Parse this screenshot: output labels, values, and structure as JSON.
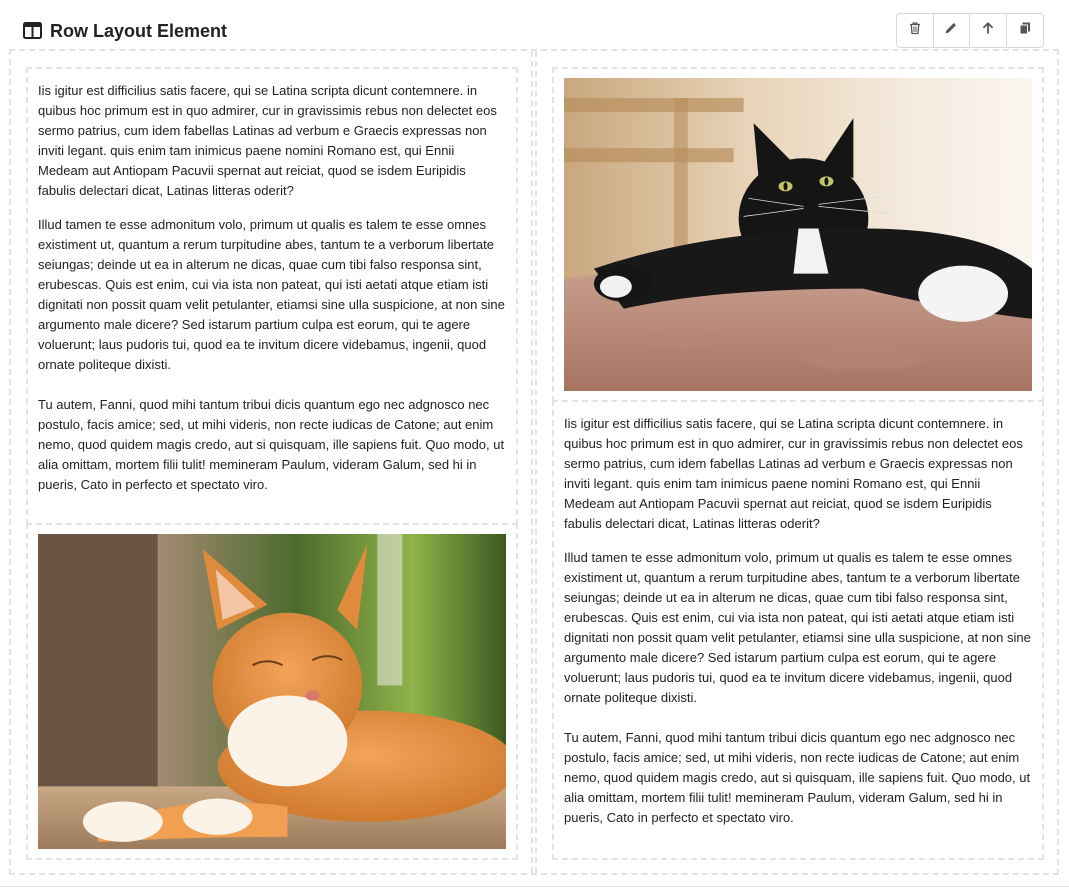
{
  "header": {
    "title": "Row Layout Element"
  },
  "toolbar": {
    "buttons": [
      {
        "icon": "trash-icon"
      },
      {
        "icon": "pencil-icon"
      },
      {
        "icon": "arrow-up-icon"
      },
      {
        "icon": "copy-icon"
      }
    ]
  },
  "left_column": {
    "text": {
      "p1": "Iis igitur est difficilius satis facere, qui se Latina scripta dicunt contemnere. in quibus hoc primum est in quo admirer, cur in gravissimis rebus non delectet eos sermo patrius, cum idem fabellas Latinas ad verbum e Graecis expressas non inviti legant. quis enim tam inimicus paene nomini Romano est, qui Ennii Medeam aut Antiopam Pacuvii spernat aut reiciat, quod se isdem Euripidis fabulis delectari dicat, Latinas litteras oderit?",
      "p2": "Illud tamen te esse admonitum volo, primum ut qualis es talem te esse omnes existiment ut, quantum a rerum turpitudine abes, tantum te a verborum libertate seiungas; deinde ut ea in alterum ne dicas, quae cum tibi falso responsa sint, erubescas. Quis est enim, cui via ista non pateat, qui isti aetati atque etiam isti dignitati non possit quam velit petulanter, etiamsi sine ulla suspicione, at non sine argumento male dicere? Sed istarum partium culpa est eorum, qui te agere voluerunt; laus pudoris tui, quod ea te invitum dicere videbamus, ingenii, quod ornate politeque dixisti.",
      "p3": "Tu autem, Fanni, quod mihi tantum tribui dicis quantum ego nec adgnosco nec postulo, facis amice; sed, ut mihi videris, non recte iudicas de Catone; aut enim nemo, quod quidem magis credo, aut si quisquam, ille sapiens fuit. Quo modo, ut alia omittam, mortem filii tulit! memineram Paulum, videram Galum, sed hi in pueris, Cato in perfecto et spectato viro."
    },
    "image": {
      "subject": "orange-cat-photo"
    }
  },
  "right_column": {
    "image": {
      "subject": "black-cat-photo"
    },
    "text": {
      "p1": "Iis igitur est difficilius satis facere, qui se Latina scripta dicunt contemnere. in quibus hoc primum est in quo admirer, cur in gravissimis rebus non delectet eos sermo patrius, cum idem fabellas Latinas ad verbum e Graecis expressas non inviti legant. quis enim tam inimicus paene nomini Romano est, qui Ennii Medeam aut Antiopam Pacuvii spernat aut reiciat, quod se isdem Euripidis fabulis delectari dicat, Latinas litteras oderit?",
      "p2": "Illud tamen te esse admonitum volo, primum ut qualis es talem te esse omnes existiment ut, quantum a rerum turpitudine abes, tantum te a verborum libertate seiungas; deinde ut ea in alterum ne dicas, quae cum tibi falso responsa sint, erubescas. Quis est enim, cui via ista non pateat, qui isti aetati atque etiam isti dignitati non possit quam velit petulanter, etiamsi sine ulla suspicione, at non sine argumento male dicere? Sed istarum partium culpa est eorum, qui te agere voluerunt; laus pudoris tui, quod ea te invitum dicere videbamus, ingenii, quod ornate politeque dixisti.",
      "p3": "Tu autem, Fanni, quod mihi tantum tribui dicis quantum ego nec adgnosco nec postulo, facis amice; sed, ut mihi videris, non recte iudicas de Catone; aut enim nemo, quod quidem magis credo, aut si quisquam, ille sapiens fuit. Quo modo, ut alia omittam, mortem filii tulit! memineram Paulum, videram Galum, sed hi in pueris, Cato in perfecto et spectato viro."
    }
  },
  "colors": {
    "dashed_border": "#e3e3e3",
    "toolbar_border": "#d8d8d8",
    "icon": "#555555",
    "text": "#222222"
  }
}
